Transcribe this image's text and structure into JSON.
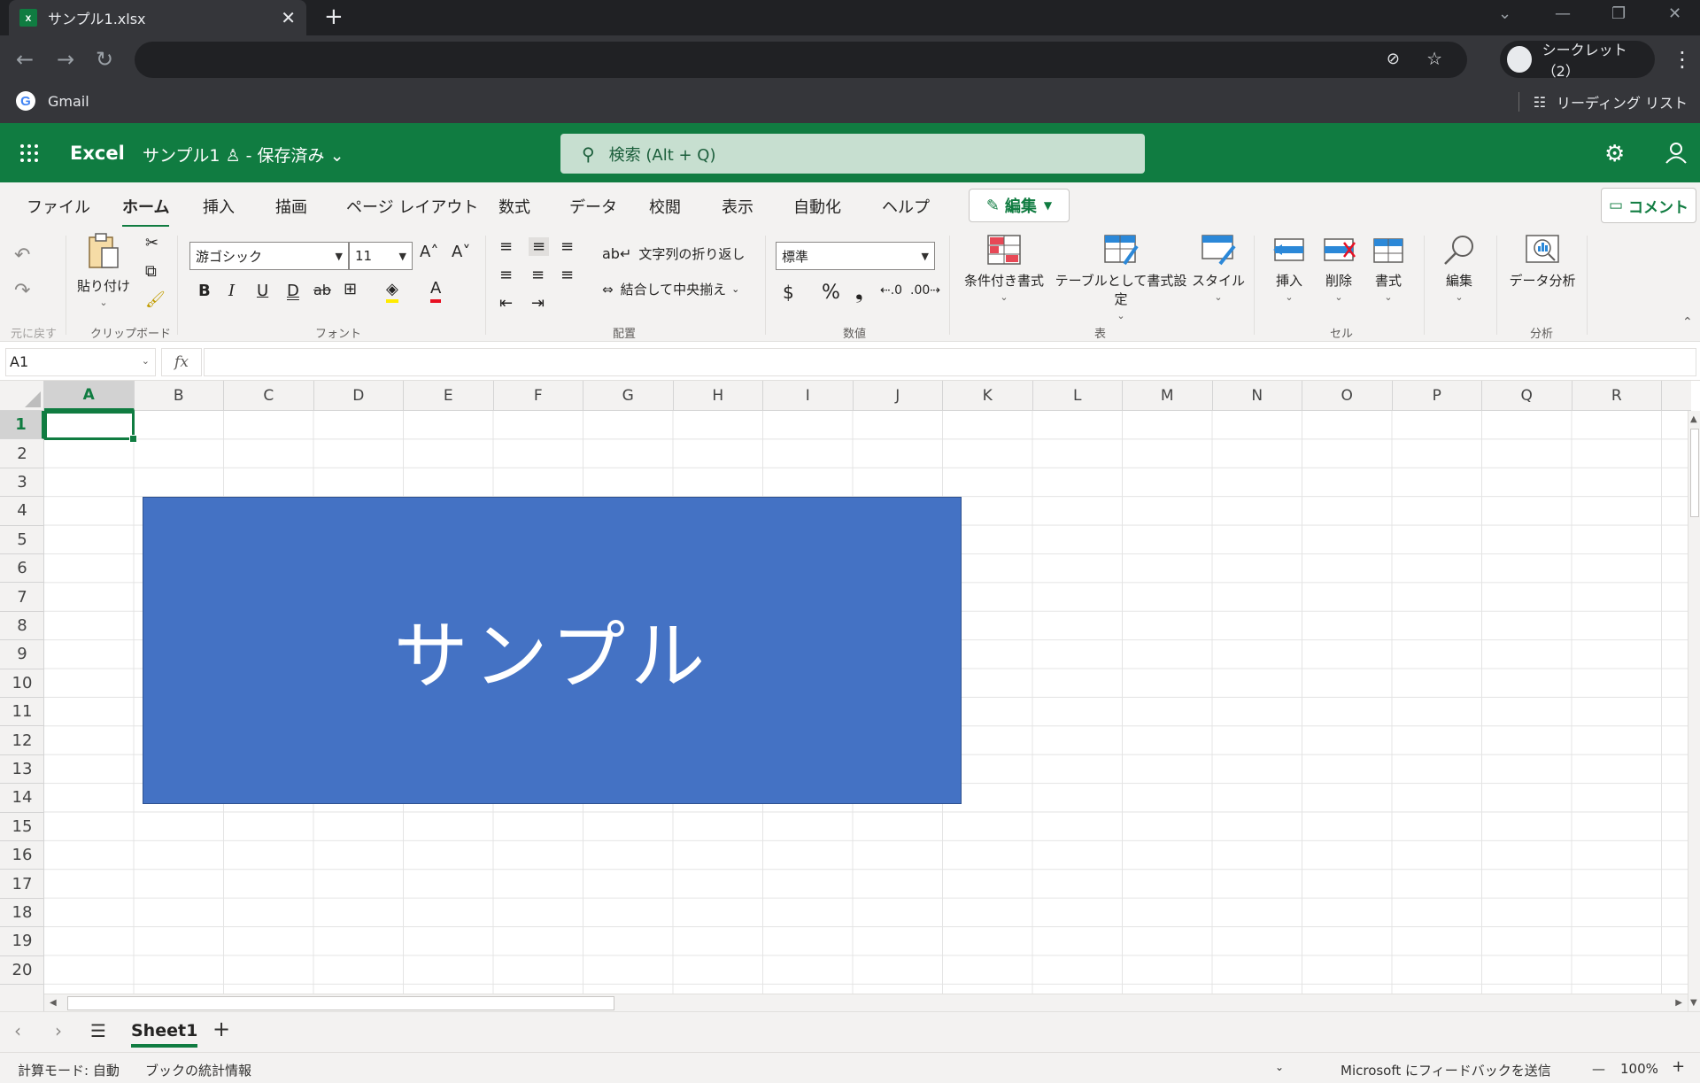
{
  "browser": {
    "tab_title": "サンプル1.xlsx",
    "tab_icon": "x",
    "close_glyph": "✕",
    "new_tab_glyph": "+",
    "incognito_label": "シークレット（2）",
    "bookmark_gmail": "Gmail",
    "reading_list": "リーディング リスト"
  },
  "appbar": {
    "app_name": "Excel",
    "file_name": "サンプル1 ♙ - 保存済み ⌄",
    "search_placeholder": "検索 (Alt + Q)"
  },
  "ribbon_tabs": [
    "ファイル",
    "ホーム",
    "挿入",
    "描画",
    "ページ レイアウト",
    "数式",
    "データ",
    "校閲",
    "表示",
    "自動化",
    "ヘルプ"
  ],
  "edit_button": "編集",
  "comment_button": "コメント",
  "ribbon": {
    "undo_group": "元に戻す",
    "clipboard_group": "クリップボード",
    "paste": "貼り付け",
    "font_group": "フォント",
    "font_name": "游ゴシック",
    "font_size": "11",
    "bold": "B",
    "italic": "I",
    "underline": "U",
    "double_underline": "D",
    "strike": "ab",
    "align_group": "配置",
    "wrap_text": "文字列の折り返し",
    "merge_center": "結合して中央揃え",
    "number_group": "数値",
    "number_format": "標準",
    "currency": "$",
    "percent": "%",
    "comma": "❟",
    "conditional": "条件付き書式",
    "format_table": "テーブルとして書式設定",
    "styles": "スタイル",
    "table_group": "表",
    "insert": "挿入",
    "delete": "削除",
    "format": "書式",
    "cells_group": "セル",
    "editing": "編集",
    "data_analysis": "データ分析",
    "analysis_group": "分析"
  },
  "formula_bar": {
    "name_box": "A1",
    "fx": "fx"
  },
  "columns": [
    "A",
    "B",
    "C",
    "D",
    "E",
    "F",
    "G",
    "H",
    "I",
    "J",
    "K",
    "L",
    "M",
    "N",
    "O",
    "P",
    "Q",
    "R"
  ],
  "rows": [
    "1",
    "2",
    "3",
    "4",
    "5",
    "6",
    "7",
    "8",
    "9",
    "10",
    "11",
    "12",
    "13",
    "14",
    "15",
    "16",
    "17",
    "18",
    "19",
    "20"
  ],
  "active_cell": "A1",
  "shape_text": "サンプル",
  "sheets": [
    "Sheet1"
  ],
  "add_sheet": "+",
  "status": {
    "calc_mode": "計算モード: 自動",
    "workbook_stats": "ブックの統計情報",
    "feedback": "Microsoft にフィードバックを送信",
    "zoom": "100%"
  },
  "colors": {
    "excel_green": "#107c41",
    "shape_fill": "#4472c4"
  }
}
